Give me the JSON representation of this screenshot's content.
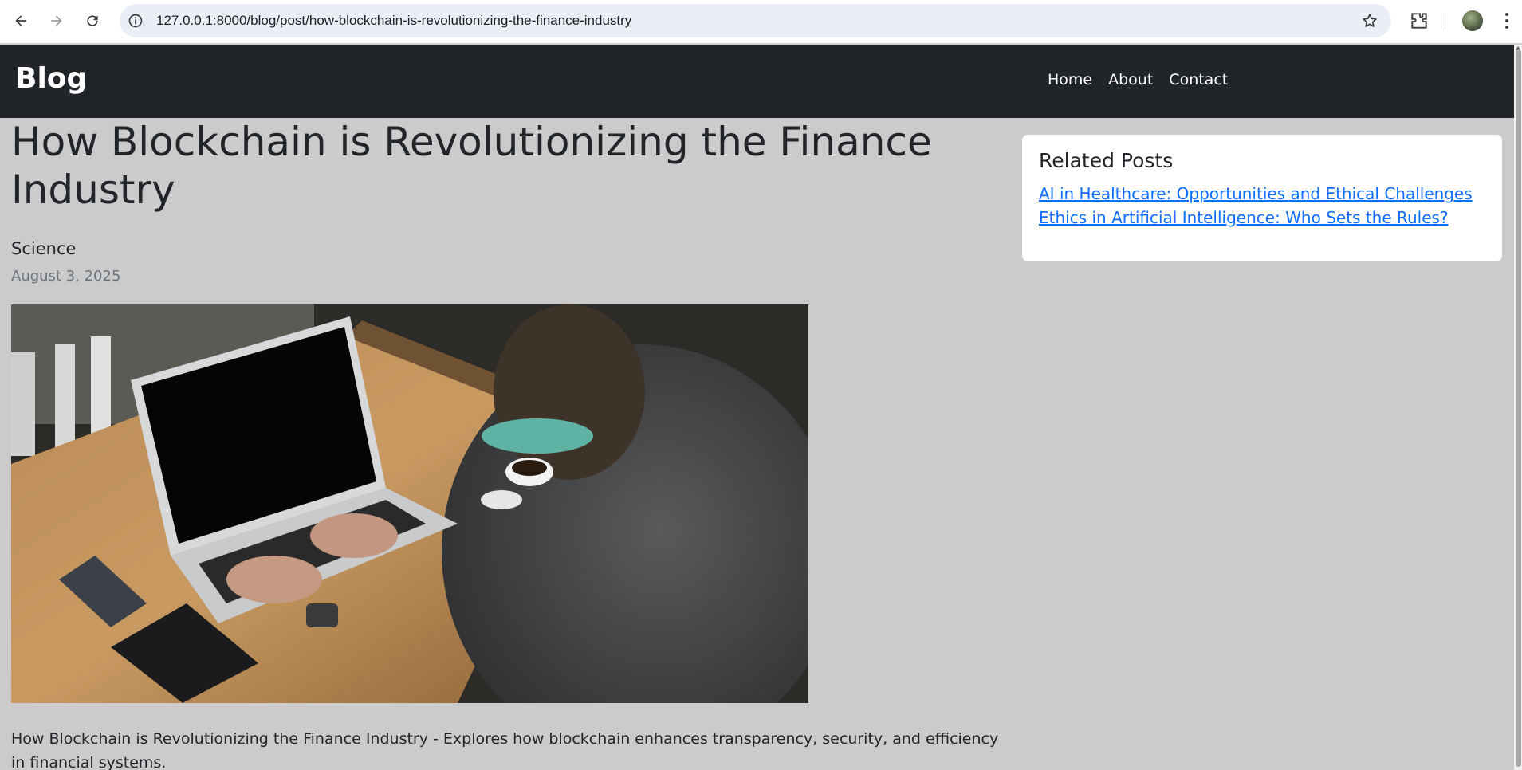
{
  "browser": {
    "url": "127.0.0.1:8000/blog/post/how-blockchain-is-revolutionizing-the-finance-industry",
    "icons": [
      "back-arrow-icon",
      "forward-arrow-icon",
      "reload-icon",
      "site-info-icon",
      "star-icon",
      "extensions-icon",
      "menu-icon"
    ]
  },
  "navbar": {
    "brand": "Blog",
    "links": [
      "Home",
      "About",
      "Contact"
    ]
  },
  "post": {
    "title": "How Blockchain is Revolutionizing the Finance Industry",
    "category": "Science",
    "date": "August 3, 2025",
    "excerpt": "How Blockchain is Revolutionizing the Finance Industry - Explores how blockchain enhances transparency, security, and efficiency in financial systems."
  },
  "sidebar": {
    "title": "Related Posts",
    "links": [
      "AI in Healthcare: Opportunities and Ethical Challenges",
      "Ethics in Artificial Intelligence: Who Sets the Rules?"
    ]
  },
  "colors": {
    "navbar_bg": "#212529",
    "page_bg": "#cbcbcb",
    "link": "#0d6efd"
  }
}
